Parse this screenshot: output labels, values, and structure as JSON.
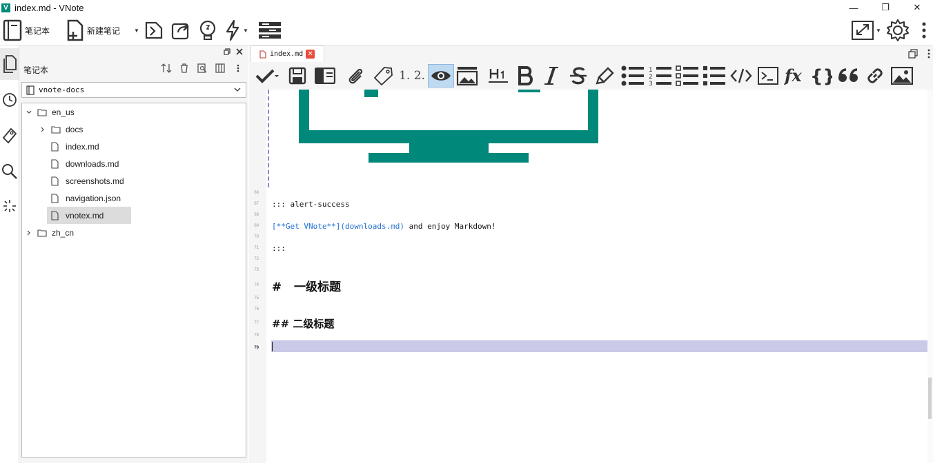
{
  "window": {
    "title": "index.md - VNote",
    "app_icon_letter": "V",
    "minimize": "—",
    "restore": "❐",
    "close": "✕"
  },
  "toolbar": {
    "notebook_label": "笔记本",
    "new_note_label": "新建笔记"
  },
  "notebook_panel": {
    "title": "笔记本",
    "selected_notebook": "vnote-docs",
    "tree": [
      {
        "label": "en_us",
        "type": "folder",
        "expanded": true
      },
      {
        "label": "docs",
        "type": "folder",
        "expanded": false
      },
      {
        "label": "index.md",
        "type": "file"
      },
      {
        "label": "downloads.md",
        "type": "file"
      },
      {
        "label": "screenshots.md",
        "type": "file"
      },
      {
        "label": "navigation.json",
        "type": "file"
      },
      {
        "label": "vnotex.md",
        "type": "file",
        "selected": true
      },
      {
        "label": "zh_cn",
        "type": "folder",
        "expanded": false
      }
    ]
  },
  "tabs": [
    {
      "label": "index.md",
      "close": "✕"
    }
  ],
  "editor_toolbar": {
    "numbered_heading_label": "1. 2."
  },
  "editor": {
    "line_numbers": [
      "66",
      "67",
      "68",
      "69",
      "70",
      "71",
      "72",
      "73",
      "74",
      "75",
      "76",
      "77",
      "78",
      "79"
    ],
    "lines": {
      "alert_open": "::: alert-success",
      "link_text": "[**Get VNote**](downloads.md)",
      "link_tail": " and enjoy Markdown!",
      "alert_close": ":::",
      "h1": "#   一级标题",
      "h2": "## 二级标题"
    }
  },
  "colors": {
    "accent": "#00897b",
    "current_line": "#cacae8",
    "link": "#1f6fd1",
    "active_button": "#bfd9f1"
  }
}
